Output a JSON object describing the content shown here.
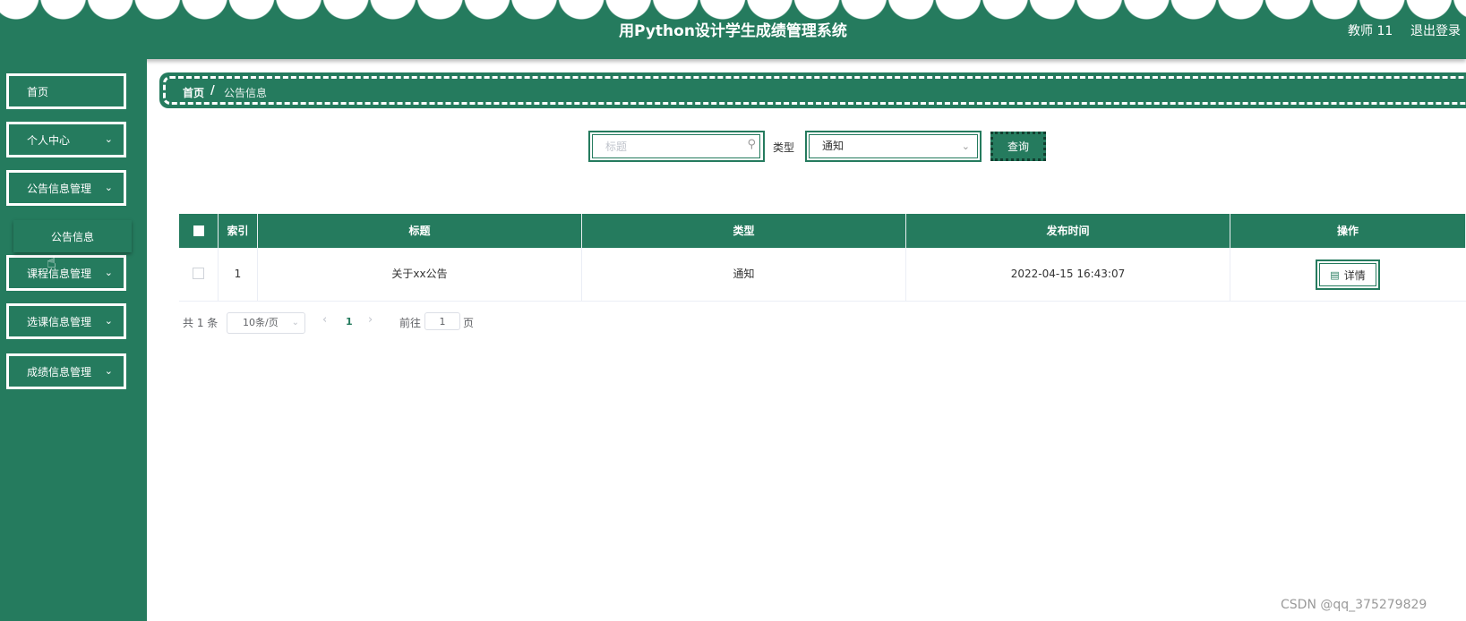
{
  "header": {
    "title": "用Python设计学生成绩管理系统",
    "user": "教师 11",
    "logout": "退出登录"
  },
  "sidebar": {
    "items": [
      {
        "label": "首页",
        "chevron": ""
      },
      {
        "label": "个人中心",
        "chevron": "⌄"
      },
      {
        "label": "公告信息管理",
        "chevron": "⌄"
      },
      {
        "label": "课程信息管理",
        "chevron": "⌄"
      },
      {
        "label": "选课信息管理",
        "chevron": "⌄"
      },
      {
        "label": "成绩信息管理",
        "chevron": "⌄"
      }
    ],
    "submenu": {
      "label": "公告信息"
    }
  },
  "breadcrumb": {
    "home": "首页",
    "separator": "/",
    "current": "公告信息"
  },
  "search": {
    "title_placeholder": "标题",
    "title_value": "",
    "type_label": "类型",
    "type_selected": "通知",
    "query_button": "查询"
  },
  "table": {
    "headers": [
      "",
      "索引",
      "标题",
      "类型",
      "发布时间",
      "操作"
    ],
    "rows": [
      {
        "index": "1",
        "title": "关于xx公告",
        "type": "通知",
        "published": "2022-04-15 16:43:07",
        "action": "详情"
      }
    ]
  },
  "pagination": {
    "total": "共 1 条",
    "page_size": "10条/页",
    "current_page": "1",
    "goto_label": "前往",
    "goto_value": "1",
    "page_unit": "页"
  },
  "watermark": "CSDN @qq_375279829",
  "colors": {
    "primary": "#257b5e",
    "header_bg": "#257b5e",
    "accent_text": "#ffffff"
  }
}
